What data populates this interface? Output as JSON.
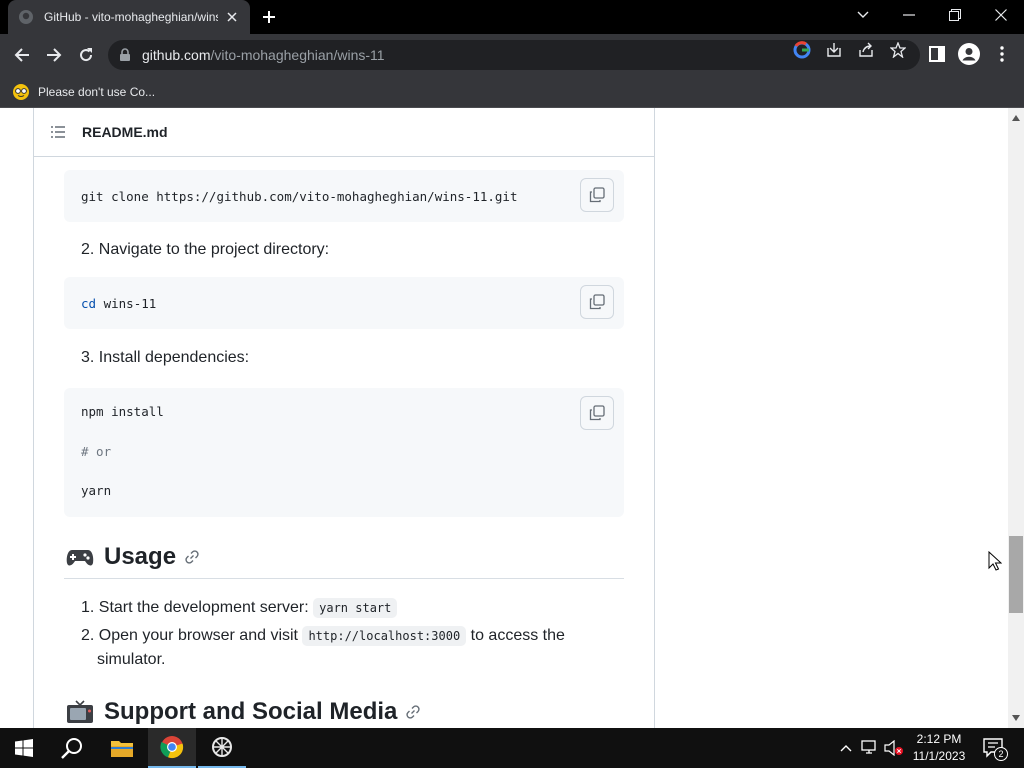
{
  "browser": {
    "tab_title": "GitHub - vito-mohagheghian/wins-11",
    "url_host": "github.com",
    "url_path": "/vito-mohagheghian/wins-11",
    "bookmark_label": "Please don't use Co..."
  },
  "readme": {
    "filename": "README.md",
    "clone_cmd": "git clone https://github.com/vito-mohagheghian/wins-11.git",
    "step2": "2. Navigate to the project directory:",
    "cd_kw": "cd",
    "cd_arg": " wins-11",
    "step3": "3. Install dependencies:",
    "npm_cmd": "npm install",
    "or_comment": "# or",
    "yarn_cmd": "yarn",
    "usage_heading": "Usage",
    "usage_1_text": "1. Start the development server:",
    "usage_1_code": "yarn start",
    "usage_2_text": "2. Open your browser and visit",
    "usage_2_code": "http://localhost:3000",
    "usage_2_suffix": "to access the",
    "usage_2_cont": "simulator.",
    "support_heading": "Support and Social Media"
  },
  "taskbar": {
    "time": "2:12 PM",
    "date": "11/1/2023",
    "notif_count": "2"
  }
}
